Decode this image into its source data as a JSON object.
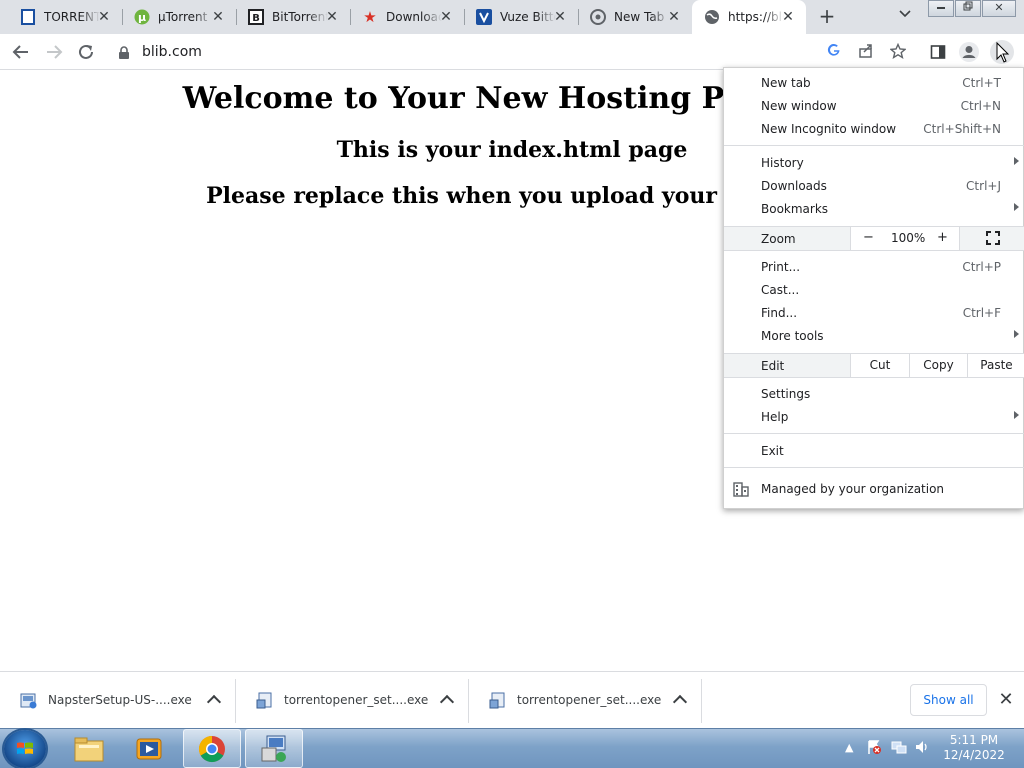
{
  "tabs": [
    {
      "title": "TORRENT",
      "icon": "document-icon",
      "color": "#1a4fa0"
    },
    {
      "title": "µTorrent",
      "icon": "utorrent-icon",
      "color": "#6fb43f"
    },
    {
      "title": "BitTorrent",
      "icon": "bittorrent-icon",
      "color": "#202124"
    },
    {
      "title": "Download",
      "icon": "star-icon",
      "color": "#d93025"
    },
    {
      "title": "Vuze Bittorrent",
      "icon": "vuze-icon",
      "color": "#1a4fa0"
    },
    {
      "title": "New Tab",
      "icon": "chrome-icon",
      "color": "#5f6368"
    },
    {
      "title": "https://blib.com",
      "icon": "globe-icon",
      "color": "#5f6368"
    }
  ],
  "address": {
    "url": "blib.com"
  },
  "page": {
    "welcome": "Welcome to Your New Hosting Package",
    "index": "This is your index.html page",
    "replace": "Please replace this when you upload your website"
  },
  "menu": {
    "new_tab": {
      "label": "New tab",
      "shortcut": "Ctrl+T"
    },
    "new_window": {
      "label": "New window",
      "shortcut": "Ctrl+N"
    },
    "incognito": {
      "label": "New Incognito window",
      "shortcut": "Ctrl+Shift+N"
    },
    "history": {
      "label": "History"
    },
    "downloads": {
      "label": "Downloads",
      "shortcut": "Ctrl+J"
    },
    "bookmarks": {
      "label": "Bookmarks"
    },
    "zoom": {
      "label": "Zoom",
      "minus": "−",
      "value": "100%",
      "plus": "+"
    },
    "print": {
      "label": "Print...",
      "shortcut": "Ctrl+P"
    },
    "cast": {
      "label": "Cast..."
    },
    "find": {
      "label": "Find...",
      "shortcut": "Ctrl+F"
    },
    "more_tools": {
      "label": "More tools"
    },
    "edit": {
      "label": "Edit",
      "cut": "Cut",
      "copy": "Copy",
      "paste": "Paste"
    },
    "settings": {
      "label": "Settings"
    },
    "help": {
      "label": "Help"
    },
    "exit": {
      "label": "Exit"
    },
    "managed": {
      "label": "Managed by your organization"
    }
  },
  "downloads": [
    {
      "name": "NapsterSetup-US-....exe"
    },
    {
      "name": "torrentopener_set....exe"
    },
    {
      "name": "torrentopener_set....exe"
    }
  ],
  "shelf": {
    "show_all": "Show all"
  },
  "clock": {
    "time": "5:11 PM",
    "date": "12/4/2022"
  }
}
